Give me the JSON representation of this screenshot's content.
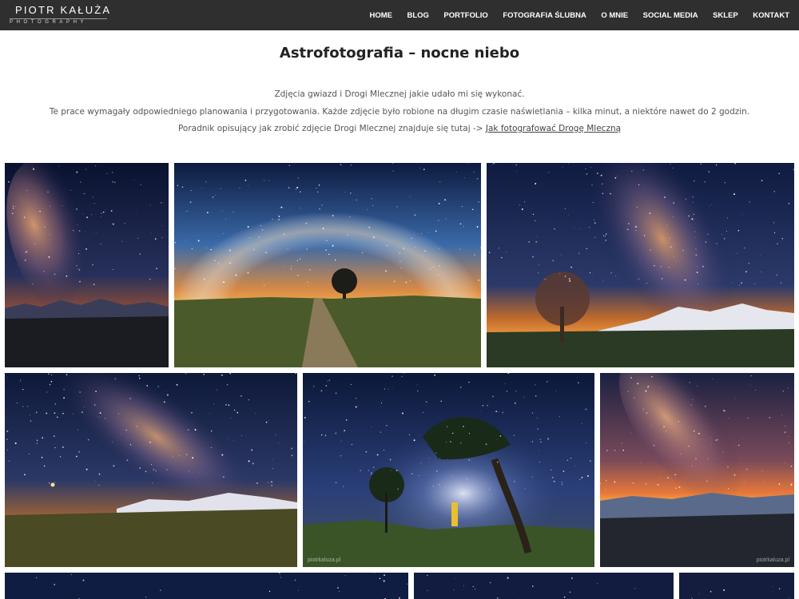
{
  "header": {
    "logo_name": "PIOTR KAŁUŻA",
    "logo_sub": "PHOTOGRAPHY",
    "nav": [
      "HOME",
      "BLOG",
      "PORTFOLIO",
      "FOTOGRAFIA ŚLUBNA",
      "O MNIE",
      "SOCIAL MEDIA",
      "SKLEP",
      "KONTAKT"
    ]
  },
  "main": {
    "title": "Astrofotografia – nocne niebo",
    "line1": "Zdjęcia gwiazd i Drogi Mlecznej jakie udało mi się wykonać.",
    "line2": "Te prace wymagały odpowiedniego planowania i przygotowania. Każde zdjęcie było robione na długim czasie naświetlania – kilka minut, a niektóre nawet do 2 godzin.",
    "line3_prefix": "Poradnik opisujący jak zrobić zdjęcie Drogi Mlecznej znajduje się tutaj -> ",
    "line3_link": "Jak fotografować Drogę Mleczną"
  },
  "gallery": {
    "watermark": "piotrkaluza.pl"
  },
  "colors": {
    "header_bg": "#2f2f2f",
    "night_sky": "#0d1a3a",
    "sunset_glow": "#e8892e"
  }
}
